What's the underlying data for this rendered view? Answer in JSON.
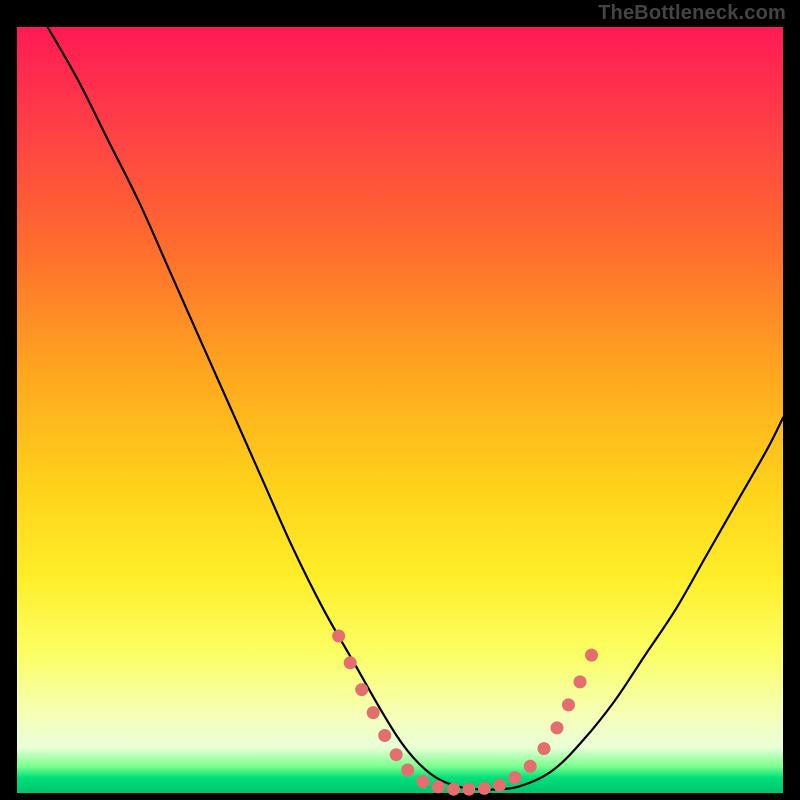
{
  "watermark": "TheBottleneck.com",
  "chart_data": {
    "type": "line",
    "title": "",
    "xlabel": "",
    "ylabel": "",
    "xlim": [
      0,
      100
    ],
    "ylim": [
      0,
      100
    ],
    "grid": false,
    "legend": false,
    "series": [
      {
        "name": "bottleneck-curve",
        "x": [
          4,
          8,
          12,
          16,
          20,
          24,
          28,
          32,
          36,
          40,
          44,
          48,
          51,
          54,
          57,
          60,
          63,
          66,
          70,
          74,
          78,
          82,
          86,
          90,
          94,
          98,
          100
        ],
        "y": [
          100,
          93,
          85,
          77,
          68,
          59,
          50,
          41,
          32,
          24,
          17,
          10,
          5.5,
          2.5,
          1,
          0.5,
          0.5,
          1,
          3,
          7,
          12,
          18,
          24,
          31,
          38,
          45,
          49
        ]
      }
    ],
    "markers": {
      "name": "highlight-dots",
      "color": "#e46e6e",
      "points": [
        {
          "x": 42.0,
          "y": 20.5
        },
        {
          "x": 43.5,
          "y": 17.0
        },
        {
          "x": 45.0,
          "y": 13.5
        },
        {
          "x": 46.5,
          "y": 10.5
        },
        {
          "x": 48.0,
          "y": 7.5
        },
        {
          "x": 49.5,
          "y": 5.0
        },
        {
          "x": 51.0,
          "y": 3.0
        },
        {
          "x": 53.0,
          "y": 1.5
        },
        {
          "x": 55.0,
          "y": 0.8
        },
        {
          "x": 57.0,
          "y": 0.5
        },
        {
          "x": 59.0,
          "y": 0.5
        },
        {
          "x": 61.0,
          "y": 0.6
        },
        {
          "x": 63.0,
          "y": 1.0
        },
        {
          "x": 65.0,
          "y": 2.0
        },
        {
          "x": 67.0,
          "y": 3.5
        },
        {
          "x": 68.8,
          "y": 5.8
        },
        {
          "x": 70.5,
          "y": 8.5
        },
        {
          "x": 72.0,
          "y": 11.5
        },
        {
          "x": 73.5,
          "y": 14.5
        },
        {
          "x": 75.0,
          "y": 18.0
        }
      ]
    },
    "background_gradient_stops": [
      {
        "pos": 0.0,
        "color": "#ff1a55"
      },
      {
        "pos": 0.28,
        "color": "#ff6a2e"
      },
      {
        "pos": 0.6,
        "color": "#ffd21a"
      },
      {
        "pos": 0.9,
        "color": "#f5ffb8"
      },
      {
        "pos": 0.98,
        "color": "#00e07a"
      },
      {
        "pos": 1.0,
        "color": "#00c46c"
      }
    ]
  }
}
